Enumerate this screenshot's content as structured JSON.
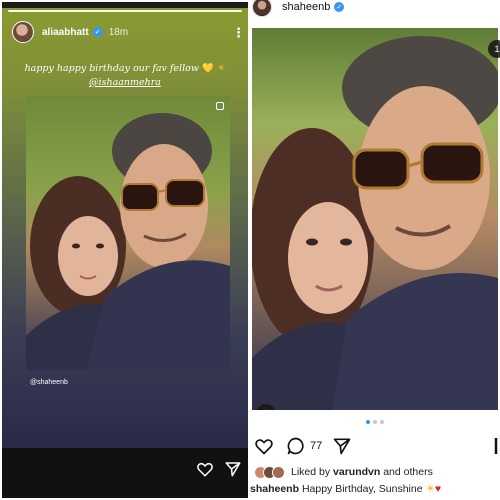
{
  "story": {
    "username": "aliaabhatt",
    "time": "18m",
    "caption_line1": "happy happy birthday our fav fellow",
    "caption_emoji1": "💛",
    "caption_emoji2": "☀",
    "mention": "@ishaanmehra",
    "photo_credit": "@shaheenb",
    "colors": {
      "top": "#8a9a32",
      "bottom": "#2a2a48"
    }
  },
  "post": {
    "username": "shaheenb",
    "carousel_counter": "1",
    "comment_count": "77",
    "likes_prefix": "Liked by",
    "likes_user": "varundvn",
    "likes_suffix": "and others",
    "caption_user": "shaheenb",
    "caption_text": "Happy Birthday, Sunshine",
    "caption_emoji1": "☀",
    "caption_emoji2": "♥",
    "accent": "#3897f0"
  },
  "icons": {
    "verified": "✓",
    "more": "⋮"
  }
}
